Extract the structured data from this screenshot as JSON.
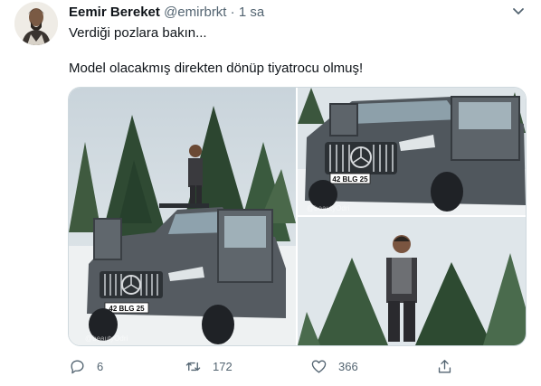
{
  "author": {
    "name": "Eemir Bereket",
    "handle": "@emirbrkt",
    "separator": "·",
    "time": "1 sa"
  },
  "tweet": {
    "line1": "Verdiği pozlara bakın...",
    "line2": "Model olacakmış direkten dönüp tiyatrocu olmuş!"
  },
  "media": {
    "photos": [
      {
        "plate": "42 BLG 25",
        "watermark": "@beautyOdri"
      },
      {
        "plate": "42 BLG 25",
        "watermark": "@beautyOdri"
      },
      {
        "plate": ""
      }
    ]
  },
  "actions": {
    "reply_count": "6",
    "retweet_count": "172",
    "like_count": "366"
  },
  "icons": {
    "more": "chevron-down-icon",
    "reply": "reply-icon",
    "retweet": "retweet-icon",
    "like": "heart-icon",
    "share": "share-icon"
  },
  "colors": {
    "text": "#0f1419",
    "muted": "#536471",
    "border": "#cfd9de"
  }
}
